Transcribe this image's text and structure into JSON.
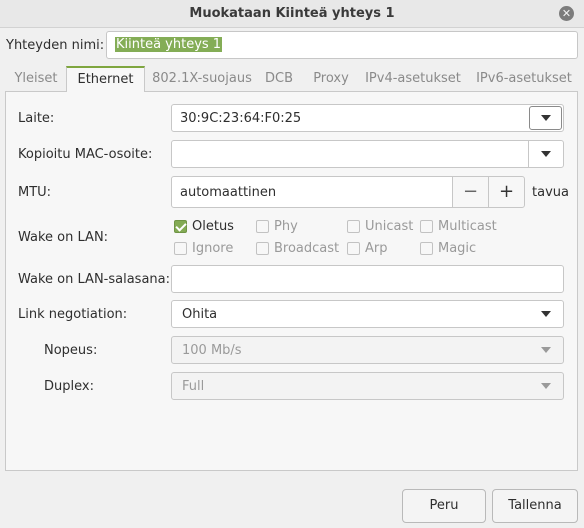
{
  "window": {
    "title": "Muokataan Kiinteä yhteys 1"
  },
  "connection_name": {
    "label": "Yhteyden nimi:",
    "value": "Kiinteä yhteys 1"
  },
  "tabs": [
    {
      "label": "Yleiset",
      "active": false
    },
    {
      "label": "Ethernet",
      "active": true
    },
    {
      "label": "802.1X-suojaus",
      "active": false
    },
    {
      "label": "DCB",
      "active": false
    },
    {
      "label": "Proxy",
      "active": false
    },
    {
      "label": "IPv4-asetukset",
      "active": false
    },
    {
      "label": "IPv6-asetukset",
      "active": false
    }
  ],
  "ethernet": {
    "device": {
      "label": "Laite:",
      "value": "30:9C:23:64:F0:25"
    },
    "cloned_mac": {
      "label": "Kopioitu MAC-osoite:",
      "value": ""
    },
    "mtu": {
      "label": "MTU:",
      "value": "automaattinen",
      "unit": "tavua",
      "minus": "−",
      "plus": "+"
    },
    "wake_on_lan": {
      "label": "Wake on LAN:",
      "options": [
        {
          "label": "Oletus",
          "checked": true
        },
        {
          "label": "Phy",
          "checked": false
        },
        {
          "label": "Unicast",
          "checked": false
        },
        {
          "label": "Multicast",
          "checked": false
        },
        {
          "label": "Ignore",
          "checked": false
        },
        {
          "label": "Broadcast",
          "checked": false
        },
        {
          "label": "Arp",
          "checked": false
        },
        {
          "label": "Magic",
          "checked": false
        }
      ]
    },
    "wol_password": {
      "label": "Wake on LAN-salasana:",
      "value": ""
    },
    "link_negotiation": {
      "label": "Link negotiation:",
      "value": "Ohita"
    },
    "speed": {
      "label": "Nopeus:",
      "value": "100 Mb/s"
    },
    "duplex": {
      "label": "Duplex:",
      "value": "Full"
    }
  },
  "buttons": {
    "cancel": "Peru",
    "save": "Tallenna"
  },
  "colors": {
    "accent": "#83aa54",
    "selection": "#84ad56"
  }
}
